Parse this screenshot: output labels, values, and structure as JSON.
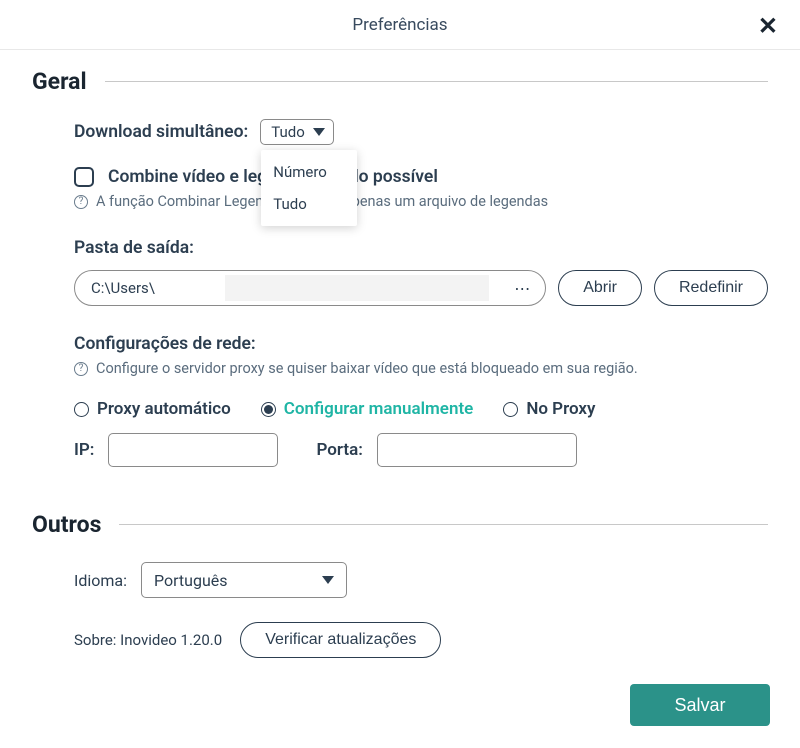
{
  "header": {
    "title": "Preferências"
  },
  "general": {
    "section_title": "Geral",
    "download_label": "Download simultâneo:",
    "download_value": "Tudo",
    "dropdown": {
      "opt1": "Número",
      "opt2": "Tudo"
    },
    "combine_label": "Combine vídeo e legenda quando possível",
    "combine_info": "A função Combinar Legendas suporta apenas um arquivo de legendas",
    "output_label": "Pasta de saída:",
    "output_value": "C:\\Users\\",
    "open_btn": "Abrir",
    "reset_btn": "Redefinir",
    "network_label": "Configurações de rede:",
    "network_info": "Configure o servidor proxy se quiser baixar vídeo que está bloqueado em sua região.",
    "proxy_auto": "Proxy automático",
    "proxy_manual": "Configurar manualmente",
    "proxy_none": "No Proxy",
    "ip_label": "IP:",
    "port_label": "Porta:"
  },
  "others": {
    "section_title": "Outros",
    "language_label": "Idioma:",
    "language_value": "Português",
    "about_label": "Sobre: Inovideo 1.20.0",
    "update_btn": "Verificar atualizações"
  },
  "footer": {
    "save": "Salvar"
  }
}
